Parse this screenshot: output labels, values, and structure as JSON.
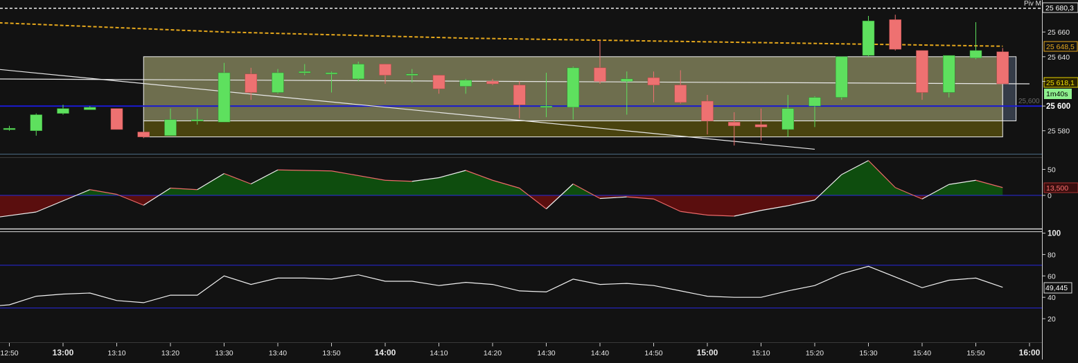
{
  "colors": {
    "background": "#121212",
    "bull": "#5ee05e",
    "bear": "#ee7171",
    "hline": "#1a1ad0",
    "pivot": "#e6a81c",
    "fill_green": "#0e4d0e",
    "fill_red": "#5a0e0e",
    "box_top": "#747452",
    "box_bottom": "#4d4710",
    "axis_text": "#e8e8e8"
  },
  "chart_data": [
    {
      "type": "candlestick",
      "panel": "price",
      "pivot_label": "Piv M",
      "pivot_value": 25680.3,
      "pivot_value_label": "25 680,3",
      "ma_label": "25 648,5",
      "last_price_label": "25 618,1",
      "timer_label": "1m40s",
      "hline_value": 25600,
      "hline_label": "25 600",
      "hline_faint_label": "25,600",
      "y_ticks": [
        25580,
        25600,
        25620,
        25640,
        25660
      ],
      "y_tick_labels": [
        "25 580",
        "25 600",
        "",
        "25 640",
        "25 660"
      ],
      "ylim": [
        25563,
        25682
      ],
      "candles": [
        {
          "t": "12:50",
          "o": 25581,
          "h": 25584,
          "l": 25580,
          "c": 25582
        },
        {
          "t": "12:55",
          "o": 25580,
          "h": 25594,
          "l": 25576,
          "c": 25593
        },
        {
          "t": "13:00",
          "o": 25594,
          "h": 25601,
          "l": 25593,
          "c": 25598
        },
        {
          "t": "13:05",
          "o": 25597,
          "h": 25600,
          "l": 25597,
          "c": 25599
        },
        {
          "t": "13:10",
          "o": 25598,
          "h": 25598,
          "l": 25581,
          "c": 25581
        },
        {
          "t": "13:15",
          "o": 25579,
          "h": 25579,
          "l": 25574,
          "c": 25575
        },
        {
          "t": "13:20",
          "o": 25576,
          "h": 25598,
          "l": 25576,
          "c": 25589
        },
        {
          "t": "13:25",
          "o": 25589,
          "h": 25598,
          "l": 25585,
          "c": 25589
        },
        {
          "t": "13:30",
          "o": 25587,
          "h": 25635,
          "l": 25587,
          "c": 25627
        },
        {
          "t": "13:35",
          "o": 25626,
          "h": 25631,
          "l": 25605,
          "c": 25611
        },
        {
          "t": "13:40",
          "o": 25611,
          "h": 25630,
          "l": 25610,
          "c": 25627
        },
        {
          "t": "13:45",
          "o": 25628,
          "h": 25634,
          "l": 25625,
          "c": 25628
        },
        {
          "t": "13:50",
          "o": 25627,
          "h": 25628,
          "l": 25611,
          "c": 25627
        },
        {
          "t": "13:55",
          "o": 25622,
          "h": 25636,
          "l": 25620,
          "c": 25634
        },
        {
          "t": "14:00",
          "o": 25634,
          "h": 25634,
          "l": 25618,
          "c": 25625
        },
        {
          "t": "14:05",
          "o": 25626,
          "h": 25630,
          "l": 25619,
          "c": 25626
        },
        {
          "t": "14:10",
          "o": 25625,
          "h": 25625,
          "l": 25610,
          "c": 25614
        },
        {
          "t": "14:15",
          "o": 25616,
          "h": 25622,
          "l": 25610,
          "c": 25621
        },
        {
          "t": "14:20",
          "o": 25620,
          "h": 25622,
          "l": 25617,
          "c": 25618
        },
        {
          "t": "14:25",
          "o": 25617,
          "h": 25620,
          "l": 25590,
          "c": 25601
        },
        {
          "t": "14:30",
          "o": 25600,
          "h": 25627,
          "l": 25591,
          "c": 25600
        },
        {
          "t": "14:35",
          "o": 25599,
          "h": 25632,
          "l": 25589,
          "c": 25631
        },
        {
          "t": "14:40",
          "o": 25631,
          "h": 25653,
          "l": 25618,
          "c": 25620
        },
        {
          "t": "14:45",
          "o": 25620,
          "h": 25628,
          "l": 25593,
          "c": 25622
        },
        {
          "t": "14:50",
          "o": 25623,
          "h": 25628,
          "l": 25603,
          "c": 25617
        },
        {
          "t": "14:55",
          "o": 25617,
          "h": 25629,
          "l": 25602,
          "c": 25603
        },
        {
          "t": "15:00",
          "o": 25604,
          "h": 25609,
          "l": 25577,
          "c": 25588
        },
        {
          "t": "15:05",
          "o": 25587,
          "h": 25595,
          "l": 25568,
          "c": 25584
        },
        {
          "t": "15:10",
          "o": 25585,
          "h": 25598,
          "l": 25572,
          "c": 25583
        },
        {
          "t": "15:15",
          "o": 25581,
          "h": 25609,
          "l": 25575,
          "c": 25598
        },
        {
          "t": "15:20",
          "o": 25600,
          "h": 25608,
          "l": 25583,
          "c": 25607
        },
        {
          "t": "15:25",
          "o": 25607,
          "h": 25640,
          "l": 25605,
          "c": 25640
        },
        {
          "t": "15:30",
          "o": 25641,
          "h": 25673,
          "l": 25640,
          "c": 25669
        },
        {
          "t": "15:35",
          "o": 25670,
          "h": 25674,
          "l": 25645,
          "c": 25646
        },
        {
          "t": "15:40",
          "o": 25645,
          "h": 25645,
          "l": 25605,
          "c": 25611
        },
        {
          "t": "15:45",
          "o": 25611,
          "h": 25641,
          "l": 25607,
          "c": 25641
        },
        {
          "t": "15:50",
          "o": 25639,
          "h": 25668,
          "l": 25638,
          "c": 25645
        },
        {
          "t": "15:55",
          "o": 25644,
          "h": 25647,
          "l": 25618,
          "c": 25618
        }
      ],
      "pivot_ma": [
        {
          "t": "12:45",
          "y": 25668
        },
        {
          "t": "13:30",
          "y": 25660
        },
        {
          "t": "14:15",
          "y": 25655
        },
        {
          "t": "15:00",
          "y": 25652
        },
        {
          "t": "15:55",
          "y": 25648.5
        }
      ],
      "trendlines": [
        {
          "t1": "12:45",
          "y1": 25631,
          "t2": "15:20",
          "y2": 25565
        },
        {
          "t1": "12:45",
          "y1": 25622,
          "t2": "16:00",
          "y2": 25618
        }
      ],
      "zones": [
        {
          "t1": "13:15",
          "t2": "15:55",
          "top": 25588,
          "bottom": 25575,
          "kind": "bottom"
        },
        {
          "t1": "13:15",
          "t2": "15:55",
          "top": 25640,
          "bottom": 25588,
          "kind": "top"
        },
        {
          "t1": "15:55",
          "t2": "15:57.5",
          "top": 25640,
          "bottom": 25588,
          "kind": "ext"
        }
      ]
    },
    {
      "type": "area",
      "panel": "oscillator",
      "last_value_label": "13,500",
      "y_tick_labels": [
        "50",
        "0"
      ],
      "y_ticks": [
        50,
        0
      ],
      "ylim": [
        -64,
        72
      ],
      "values": [
        {
          "t": "12:45",
          "v": -46
        },
        {
          "t": "12:55",
          "v": -32
        },
        {
          "t": "13:05",
          "v": 11
        },
        {
          "t": "13:10",
          "v": 2
        },
        {
          "t": "13:15",
          "v": -19
        },
        {
          "t": "13:20",
          "v": 14
        },
        {
          "t": "13:25",
          "v": 11
        },
        {
          "t": "13:30",
          "v": 42
        },
        {
          "t": "13:35",
          "v": 22
        },
        {
          "t": "13:40",
          "v": 49
        },
        {
          "t": "13:50",
          "v": 47
        },
        {
          "t": "14:00",
          "v": 29
        },
        {
          "t": "14:05",
          "v": 27
        },
        {
          "t": "14:10",
          "v": 34
        },
        {
          "t": "14:15",
          "v": 48
        },
        {
          "t": "14:20",
          "v": 29
        },
        {
          "t": "14:25",
          "v": 14
        },
        {
          "t": "14:30",
          "v": -26
        },
        {
          "t": "14:35",
          "v": 22
        },
        {
          "t": "14:40",
          "v": -6
        },
        {
          "t": "14:45",
          "v": -3
        },
        {
          "t": "14:50",
          "v": -7
        },
        {
          "t": "14:55",
          "v": -31
        },
        {
          "t": "15:00",
          "v": -38
        },
        {
          "t": "15:05",
          "v": -40
        },
        {
          "t": "15:10",
          "v": -29
        },
        {
          "t": "15:15",
          "v": -20
        },
        {
          "t": "15:20",
          "v": -9
        },
        {
          "t": "15:25",
          "v": 40
        },
        {
          "t": "15:30",
          "v": 67
        },
        {
          "t": "15:35",
          "v": 15
        },
        {
          "t": "15:40",
          "v": -7
        },
        {
          "t": "15:45",
          "v": 21
        },
        {
          "t": "15:50",
          "v": 29
        },
        {
          "t": "15:55",
          "v": 15
        }
      ]
    },
    {
      "type": "line",
      "panel": "rsi",
      "last_value_label": "49,445",
      "y_ticks": [
        100,
        80,
        60,
        40,
        20
      ],
      "y_tick_labels": [
        "100",
        "80",
        "60",
        "40",
        "20"
      ],
      "levels": [
        70,
        30
      ],
      "ylim": [
        -2,
        101
      ],
      "values": [
        {
          "t": "12:45",
          "v": 31
        },
        {
          "t": "12:50",
          "v": 33
        },
        {
          "t": "12:55",
          "v": 41
        },
        {
          "t": "13:00",
          "v": 43
        },
        {
          "t": "13:05",
          "v": 44
        },
        {
          "t": "13:10",
          "v": 37
        },
        {
          "t": "13:15",
          "v": 35
        },
        {
          "t": "13:20",
          "v": 42
        },
        {
          "t": "13:25",
          "v": 42
        },
        {
          "t": "13:30",
          "v": 60
        },
        {
          "t": "13:35",
          "v": 52
        },
        {
          "t": "13:40",
          "v": 58
        },
        {
          "t": "13:45",
          "v": 58
        },
        {
          "t": "13:50",
          "v": 57
        },
        {
          "t": "13:55",
          "v": 61
        },
        {
          "t": "14:00",
          "v": 55
        },
        {
          "t": "14:05",
          "v": 55
        },
        {
          "t": "14:10",
          "v": 51
        },
        {
          "t": "14:15",
          "v": 54
        },
        {
          "t": "14:20",
          "v": 52
        },
        {
          "t": "14:25",
          "v": 46
        },
        {
          "t": "14:30",
          "v": 45
        },
        {
          "t": "14:35",
          "v": 57
        },
        {
          "t": "14:40",
          "v": 52
        },
        {
          "t": "14:45",
          "v": 53
        },
        {
          "t": "14:50",
          "v": 51
        },
        {
          "t": "14:55",
          "v": 46
        },
        {
          "t": "15:00",
          "v": 41
        },
        {
          "t": "15:05",
          "v": 40
        },
        {
          "t": "15:10",
          "v": 40
        },
        {
          "t": "15:15",
          "v": 46
        },
        {
          "t": "15:20",
          "v": 51
        },
        {
          "t": "15:25",
          "v": 62
        },
        {
          "t": "15:30",
          "v": 69
        },
        {
          "t": "15:35",
          "v": 59
        },
        {
          "t": "15:40",
          "v": 49
        },
        {
          "t": "15:45",
          "v": 56
        },
        {
          "t": "15:50",
          "v": 58
        },
        {
          "t": "15:55",
          "v": 49.4
        }
      ]
    }
  ],
  "x_axis": {
    "ticks": [
      {
        "t": "12:50",
        "label": "12:50",
        "bold": false
      },
      {
        "t": "13:00",
        "label": "13:00",
        "bold": true
      },
      {
        "t": "13:10",
        "label": "13:10",
        "bold": false
      },
      {
        "t": "13:20",
        "label": "13:20",
        "bold": false
      },
      {
        "t": "13:30",
        "label": "13:30",
        "bold": false
      },
      {
        "t": "13:40",
        "label": "13:40",
        "bold": false
      },
      {
        "t": "13:50",
        "label": "13:50",
        "bold": false
      },
      {
        "t": "14:00",
        "label": "14:00",
        "bold": true
      },
      {
        "t": "14:10",
        "label": "14:10",
        "bold": false
      },
      {
        "t": "14:20",
        "label": "14:20",
        "bold": false
      },
      {
        "t": "14:30",
        "label": "14:30",
        "bold": false
      },
      {
        "t": "14:40",
        "label": "14:40",
        "bold": false
      },
      {
        "t": "14:50",
        "label": "14:50",
        "bold": false
      },
      {
        "t": "15:00",
        "label": "15:00",
        "bold": true
      },
      {
        "t": "15:10",
        "label": "15:10",
        "bold": false
      },
      {
        "t": "15:20",
        "label": "15:20",
        "bold": false
      },
      {
        "t": "15:30",
        "label": "15:30",
        "bold": false
      },
      {
        "t": "15:40",
        "label": "15:40",
        "bold": false
      },
      {
        "t": "15:50",
        "label": "15:50",
        "bold": false
      },
      {
        "t": "16:00",
        "label": "16:00",
        "bold": true
      }
    ]
  }
}
